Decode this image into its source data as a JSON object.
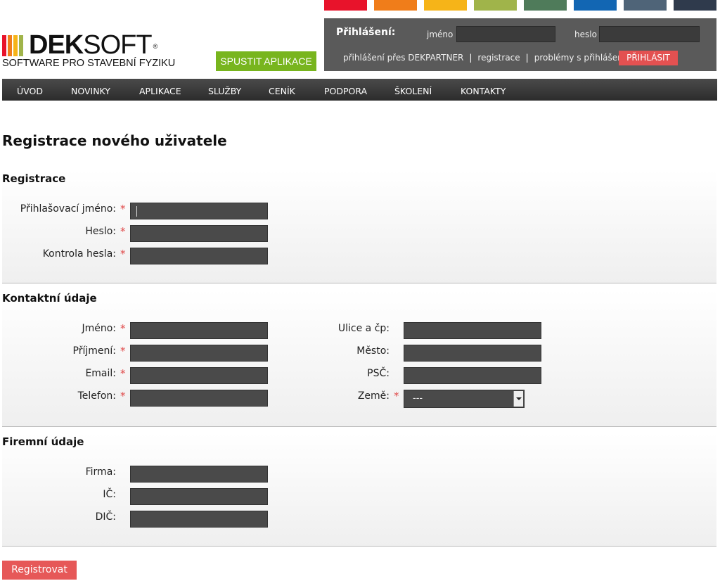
{
  "colors": {
    "strip": [
      "#e8132b",
      "#f07d1a",
      "#f6b418",
      "#a0b44a",
      "#4f7b5a",
      "#1266b3",
      "#4f6478",
      "#2f3a4c"
    ],
    "accent_green": "#78b51e",
    "accent_red": "#e35151"
  },
  "logo": {
    "brand_bold": "DEK",
    "brand_light": "SOFT",
    "registered": "®",
    "tagline": "SOFTWARE PRO STAVEBNÍ FYZIKU",
    "bar_colors": [
      "#e8132b",
      "#f07d1a",
      "#f6b418",
      "#a0b44a"
    ]
  },
  "run_app_label": "SPUSTIT APLIKACE",
  "login": {
    "title": "Přihlášení:",
    "name_label": "jméno",
    "password_label": "heslo",
    "link_dekpartner": "přihlášení přes DEKPARTNER",
    "link_register": "registrace",
    "link_problems": "problémy s přihlášením",
    "separator": "|",
    "button": "PŘIHLÁSIT"
  },
  "nav": [
    "ÚVOD",
    "NOVINKY",
    "APLIKACE",
    "SLUŽBY",
    "CENÍK",
    "PODPORA",
    "ŠKOLENÍ",
    "KONTAKTY"
  ],
  "page_title": "Registrace nového uživatele",
  "sections": {
    "registrace": {
      "title": "Registrace",
      "fields": [
        "Přihlašovací jméno:",
        "Heslo:",
        "Kontrola hesla:"
      ]
    },
    "kontakt": {
      "title": "Kontaktní údaje",
      "left_fields": [
        "Jméno:",
        "Příjmení:",
        "Email:",
        "Telefon:"
      ],
      "right_fields": [
        "Ulice a čp:",
        "Město:",
        "PSČ:",
        "Země:"
      ],
      "country_value": "---"
    },
    "firma": {
      "title": "Firemní údaje",
      "fields": [
        "Firma:",
        "IČ:",
        "DIČ:"
      ]
    }
  },
  "required_mark": "*",
  "submit_label": "Registrovat"
}
